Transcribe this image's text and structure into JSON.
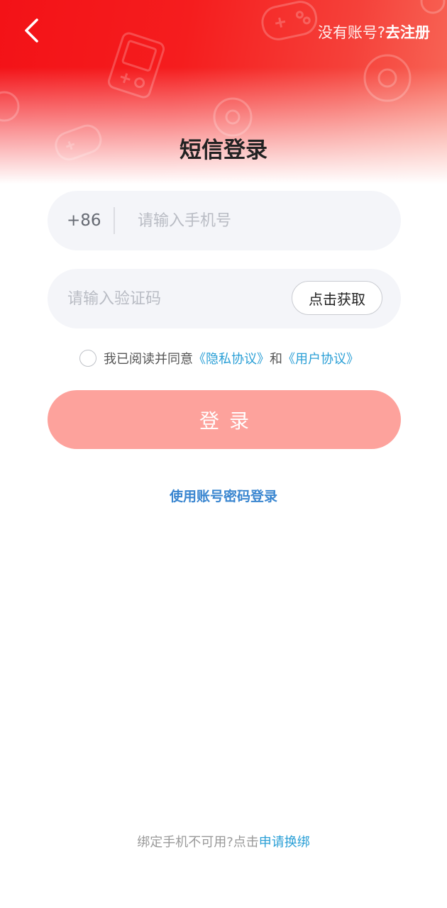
{
  "header": {
    "register_prompt": "没有账号?",
    "register_link": "去注册"
  },
  "title": "短信登录",
  "phone_field": {
    "country_code": "+86",
    "placeholder": "请输入手机号",
    "value": ""
  },
  "code_field": {
    "placeholder": "请输入验证码",
    "value": "",
    "get_code_label": "点击获取"
  },
  "agreement": {
    "prefix": "我已阅读并同意",
    "privacy_link": "《隐私协议》",
    "conjunction": "和",
    "user_link": "《用户协议》",
    "checked": false
  },
  "login_button": "登录",
  "alt_login_link": "使用账号密码登录",
  "footer": {
    "prompt": "绑定手机不可用?点击",
    "link": "申请换绑"
  },
  "colors": {
    "brand_red": "#f31217",
    "login_button": "#fda29c",
    "link_blue": "#2a9fd6",
    "alt_link_blue": "#3a86d0"
  },
  "icons": [
    "back-arrow-icon",
    "gamepad-icon",
    "handheld-console-icon"
  ]
}
